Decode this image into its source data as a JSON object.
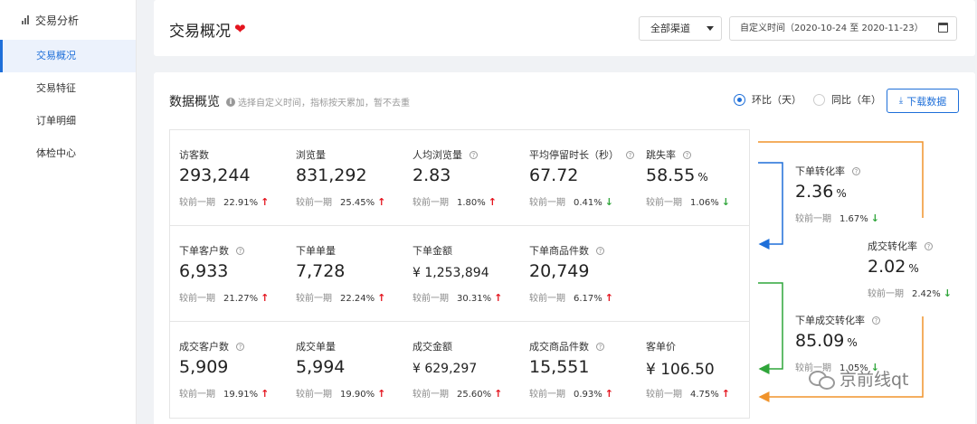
{
  "sidebar": {
    "header": "交易分析",
    "items": [
      {
        "label": "交易概况",
        "active": true
      },
      {
        "label": "交易特征",
        "active": false
      },
      {
        "label": "订单明细",
        "active": false
      },
      {
        "label": "体检中心",
        "active": false
      }
    ]
  },
  "header": {
    "title": "交易概况",
    "channel": "全部渠道",
    "date_range": "自定义时间（2020-10-24 至 2020-11-23）"
  },
  "overview": {
    "title": "数据概览",
    "hint": "选择自定义时间，指标按天累加，暂不去重",
    "radio_mom": "环比（天）",
    "radio_yoy": "同比（年）",
    "download": "下载数据",
    "compare_label": "较前一期"
  },
  "metrics": {
    "visitors": {
      "label": "访客数",
      "value": "293,244",
      "pct": "22.91%",
      "dir": "up"
    },
    "pageviews": {
      "label": "浏览量",
      "value": "831,292",
      "pct": "25.45%",
      "dir": "up"
    },
    "pv_per_user": {
      "label": "人均浏览量",
      "value": "2.83",
      "pct": "1.80%",
      "dir": "up"
    },
    "avg_stay": {
      "label": "平均停留时长（秒）",
      "value": "67.72",
      "pct": "0.41%",
      "dir": "down"
    },
    "bounce": {
      "label": "跳失率",
      "value": "58.55",
      "unit": "%",
      "pct": "1.06%",
      "dir": "down"
    },
    "order_customers": {
      "label": "下单客户数",
      "value": "6,933",
      "pct": "21.27%",
      "dir": "up"
    },
    "order_count": {
      "label": "下单单量",
      "value": "7,728",
      "pct": "22.24%",
      "dir": "up"
    },
    "order_amount": {
      "label": "下单金额",
      "value": "¥ 1,253,894",
      "pct": "30.31%",
      "dir": "up"
    },
    "order_items": {
      "label": "下单商品件数",
      "value": "20,749",
      "pct": "6.17%",
      "dir": "up"
    },
    "deal_customers": {
      "label": "成交客户数",
      "value": "5,909",
      "pct": "19.91%",
      "dir": "up"
    },
    "deal_count": {
      "label": "成交单量",
      "value": "5,994",
      "pct": "19.90%",
      "dir": "up"
    },
    "deal_amount": {
      "label": "成交金额",
      "value": "¥ 629,297",
      "pct": "25.60%",
      "dir": "up"
    },
    "deal_items": {
      "label": "成交商品件数",
      "value": "15,551",
      "pct": "0.93%",
      "dir": "up"
    },
    "avg_price": {
      "label": "客单价",
      "value": "¥ 106.50",
      "pct": "4.75%",
      "dir": "up"
    }
  },
  "conversion": {
    "order_rate": {
      "label": "下单转化率",
      "value": "2.36",
      "unit": "%",
      "pct": "1.67%",
      "dir": "down"
    },
    "deal_rate": {
      "label": "成交转化率",
      "value": "2.02",
      "unit": "%",
      "pct": "2.42%",
      "dir": "down"
    },
    "order_deal_rate": {
      "label": "下单成交转化率",
      "value": "85.09",
      "unit": "%",
      "pct": "1.05%",
      "dir": "down"
    }
  },
  "arrows": {
    "up": "↑",
    "down": "↓"
  },
  "colors": {
    "accent": "#1e6fd9",
    "up": "#e4141e",
    "down": "#2fa53a",
    "flow_blue": "#1e6fd9",
    "flow_green": "#2fa53a",
    "flow_orange": "#f0932b"
  },
  "watermark": "京前线qt"
}
